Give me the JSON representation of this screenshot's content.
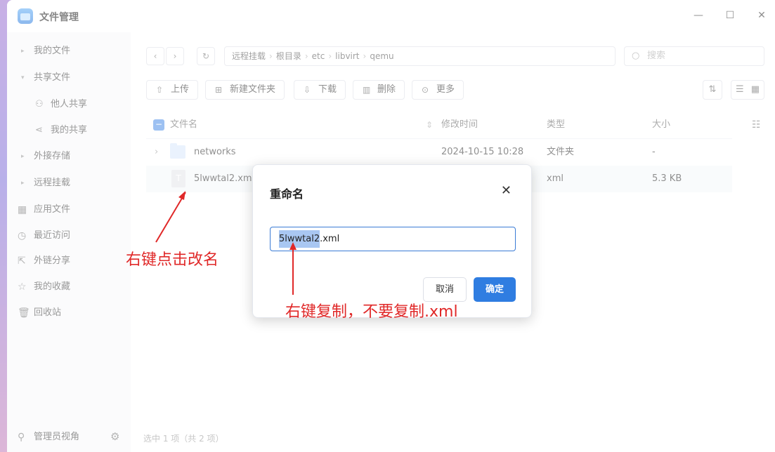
{
  "app": {
    "title": "文件管理"
  },
  "window_controls": {
    "minimize": "—",
    "maximize": "☐",
    "close": "✕"
  },
  "sidebar": {
    "items": [
      {
        "label": "我的文件",
        "icon": "caret-right-icon"
      },
      {
        "label": "共享文件",
        "icon": "caret-down-icon"
      },
      {
        "label": "他人共享",
        "icon": "users-icon"
      },
      {
        "label": "我的共享",
        "icon": "share-icon"
      },
      {
        "label": "外接存储",
        "icon": "caret-right-icon"
      },
      {
        "label": "远程挂载",
        "icon": "caret-right-icon"
      },
      {
        "label": "应用文件",
        "icon": "apps-icon"
      },
      {
        "label": "最近访问",
        "icon": "clock-icon"
      },
      {
        "label": "外链分享",
        "icon": "link-share-icon"
      },
      {
        "label": "我的收藏",
        "icon": "star-icon"
      },
      {
        "label": "回收站",
        "icon": "trash-icon"
      }
    ],
    "bottom_label": "管理员视角"
  },
  "path": {
    "segments": [
      "远程挂载",
      "根目录",
      "etc",
      "libvirt",
      "qemu"
    ]
  },
  "search": {
    "placeholder": "搜索"
  },
  "toolbar": {
    "upload": "上传",
    "new_folder": "新建文件夹",
    "download": "下载",
    "delete": "删除",
    "more": "更多"
  },
  "table": {
    "headers": [
      "文件名",
      "修改时间",
      "类型",
      "大小"
    ],
    "rows": [
      {
        "name": "networks",
        "modified": "2024-10-15 10:28",
        "type": "文件夹",
        "size": "-"
      },
      {
        "name": "5lwwtal2.xml",
        "modified": "",
        "type": "xml",
        "size": "5.3 KB"
      }
    ]
  },
  "status": {
    "text": "选中 1 项（共 2 项）"
  },
  "dialog": {
    "title": "重命名",
    "input_selected": "5lwwtal2",
    "input_rest": ".xml",
    "cancel": "取消",
    "ok": "确定"
  },
  "annotations": {
    "left": "右键点击改名",
    "bottom": "右键复制，不要复制.xml"
  },
  "colors": {
    "accent": "#2f7de1",
    "annotation": "#e02828"
  }
}
